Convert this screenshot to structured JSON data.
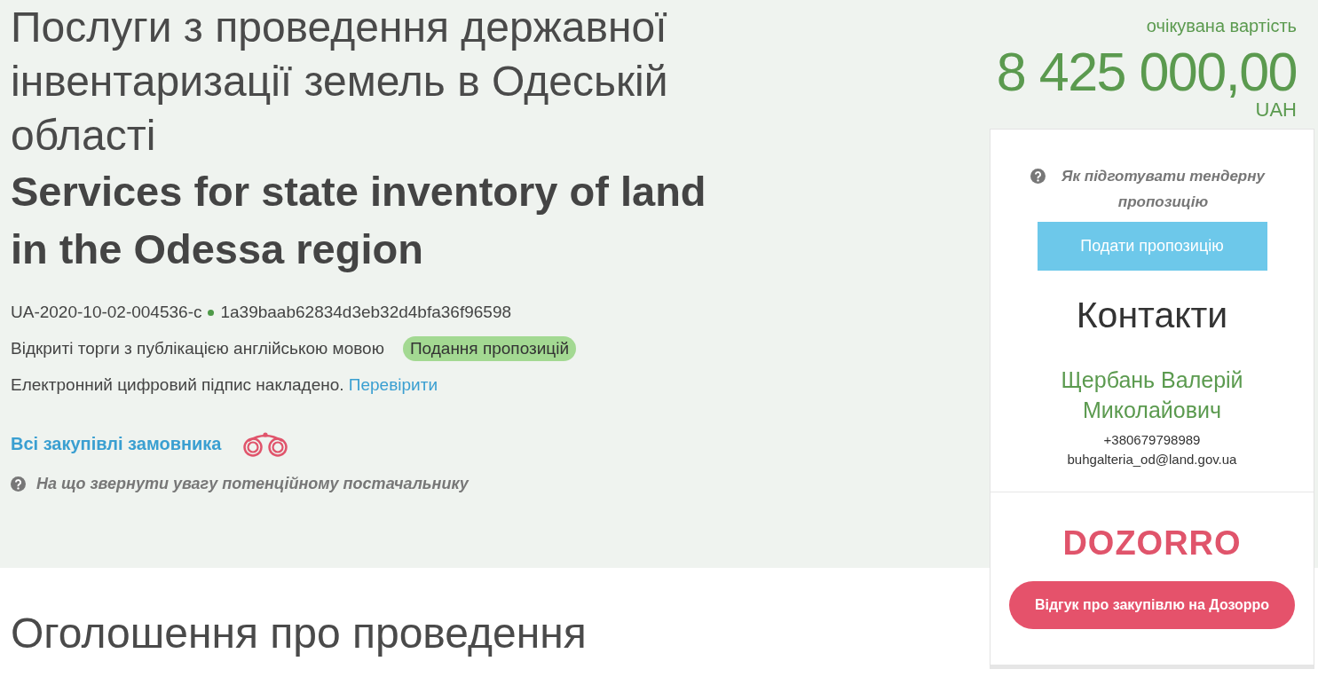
{
  "tender": {
    "title": "Послуги з проведення державної інвентаризації земель в Одеській області",
    "title_en": "Services for state inventory of land in the Odessa region",
    "id": "UA-2020-10-02-004536-c",
    "hash": "1a39baab62834d3eb32d4bfa36f96598",
    "procedure": "Відкриті торги з публікацією англійською мовою",
    "status": "Подання пропозицій",
    "signature": {
      "text": "Електронний цифровий підпис накладено.",
      "link": "Перевірити"
    },
    "buyer_link": "Всі закупівлі замовника",
    "hint": "На що звернути увагу потенційному постачальнику"
  },
  "section_heading": "Оголошення про проведення",
  "price": {
    "caption": "очікувана вартість",
    "amount": "8 425 000,00",
    "currency": "UAH"
  },
  "sidebar": {
    "help_link": "Як підготувати тендерну пропозицію",
    "submit_button": "Подати пропозицію",
    "contacts_heading": "Контакти",
    "contact": {
      "name": "Щербань Валерій Миколайович",
      "phone": "+380679798989",
      "email": "buhgalteria_od@land.gov.ua"
    },
    "logo": "DOZORRO",
    "feedback_button": "Відгук про закупівлю на Дозорро"
  }
}
